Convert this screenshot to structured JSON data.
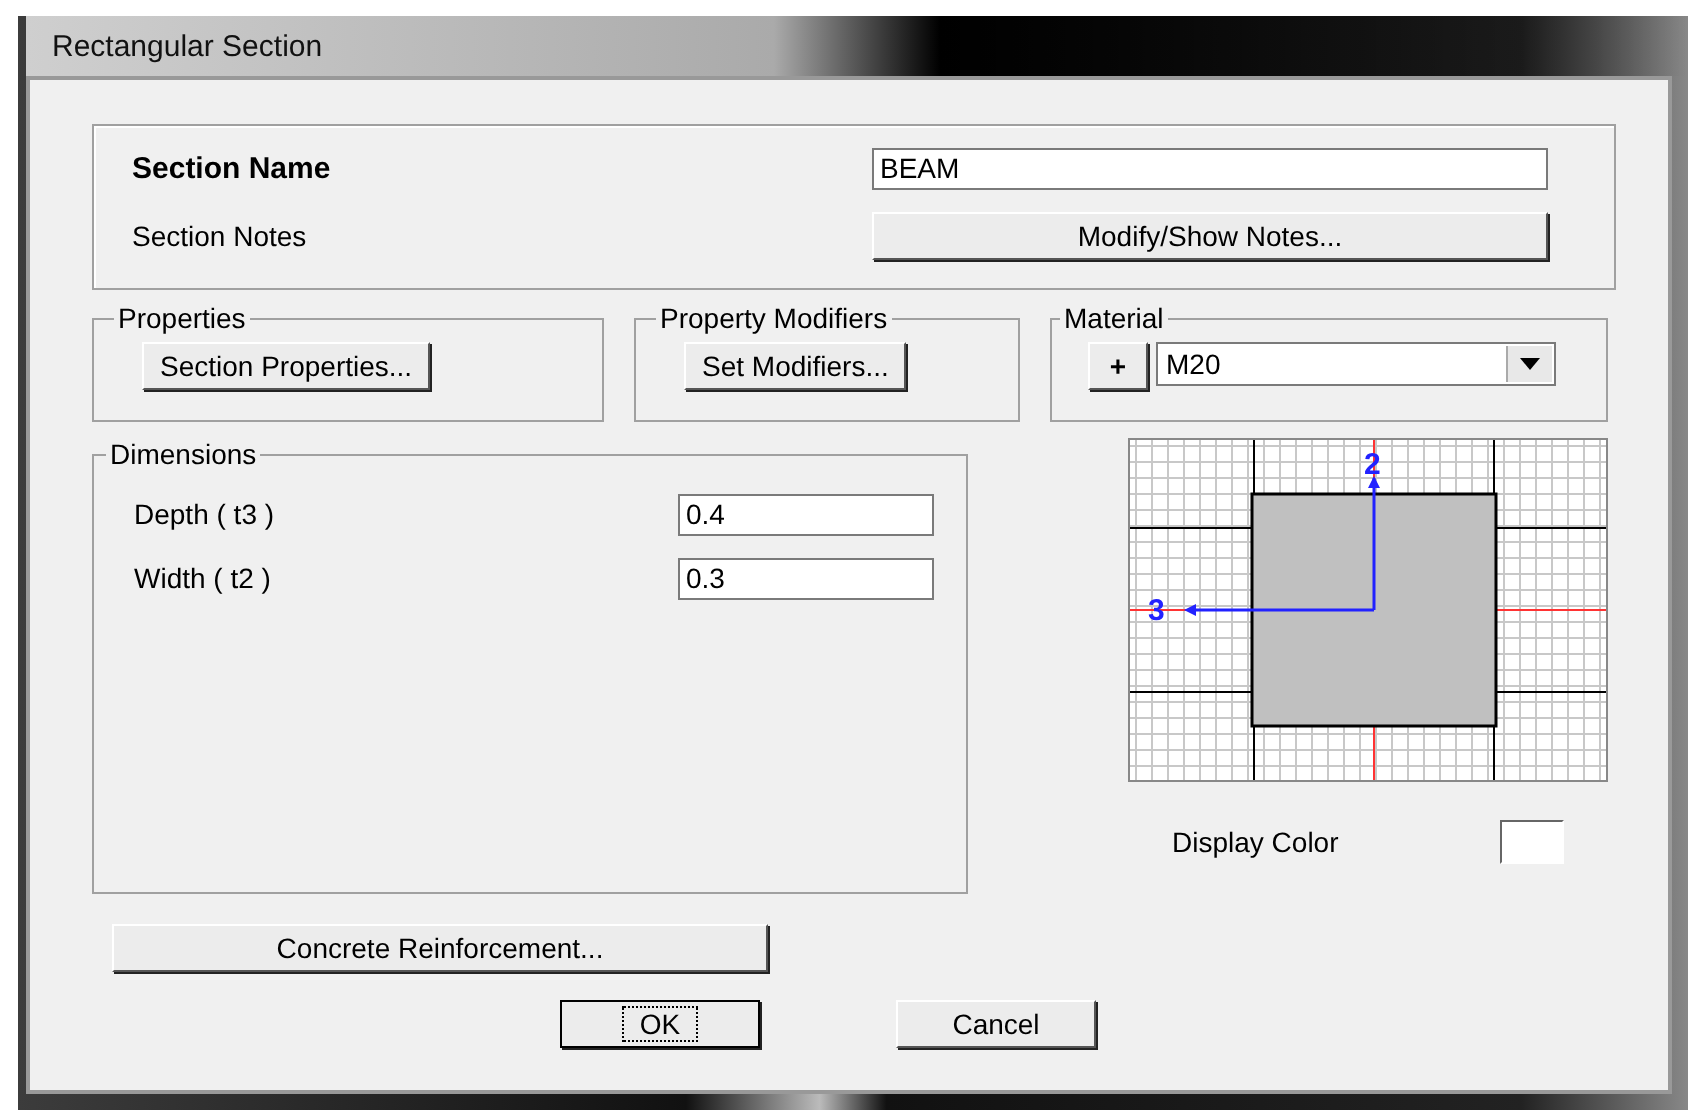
{
  "window": {
    "title": "Rectangular Section"
  },
  "section_name": {
    "label": "Section Name",
    "value": "BEAM"
  },
  "section_notes": {
    "label": "Section Notes",
    "button": "Modify/Show Notes..."
  },
  "properties": {
    "title": "Properties",
    "button": "Section Properties..."
  },
  "property_modifiers": {
    "title": "Property Modifiers",
    "button": "Set Modifiers..."
  },
  "material": {
    "title": "Material",
    "add_button": "+",
    "value": "M20"
  },
  "dimensions": {
    "title": "Dimensions",
    "fields": [
      {
        "label": "Depth  ( t3 )",
        "value": "0.4"
      },
      {
        "label": "Width  ( t2 )",
        "value": "0.3"
      }
    ]
  },
  "preview": {
    "axis_2": "2",
    "axis_3": "3"
  },
  "display_color": {
    "label": "Display Color"
  },
  "reinforcement_button": "Concrete Reinforcement...",
  "buttons": [
    {
      "label": "OK",
      "focused": true
    },
    {
      "label": "Cancel",
      "focused": false
    }
  ]
}
